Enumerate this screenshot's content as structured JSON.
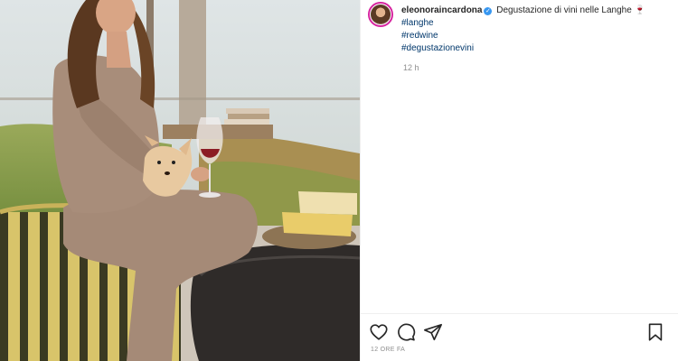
{
  "post": {
    "image_alt": "",
    "user": {
      "username": "eleonoraincardona",
      "verified": true
    },
    "caption": {
      "text": "Degustazione di vini nelle Langhe",
      "emoji": "🍷",
      "hashtags": [
        "#langhe",
        "#redwine",
        "#degustazionevini"
      ]
    },
    "comment_time": "12 h",
    "actions": {
      "like_icon": "heart-icon",
      "comment_icon": "comment-icon",
      "share_icon": "paper-plane-icon",
      "save_icon": "bookmark-icon"
    },
    "timestamp": "12 ORE FA"
  },
  "colors": {
    "username": "#262626",
    "hashtag": "#00376b",
    "verified_badge": "#3897f0",
    "muted": "#8e8e8e",
    "avatar_ring": "#d6249f"
  }
}
